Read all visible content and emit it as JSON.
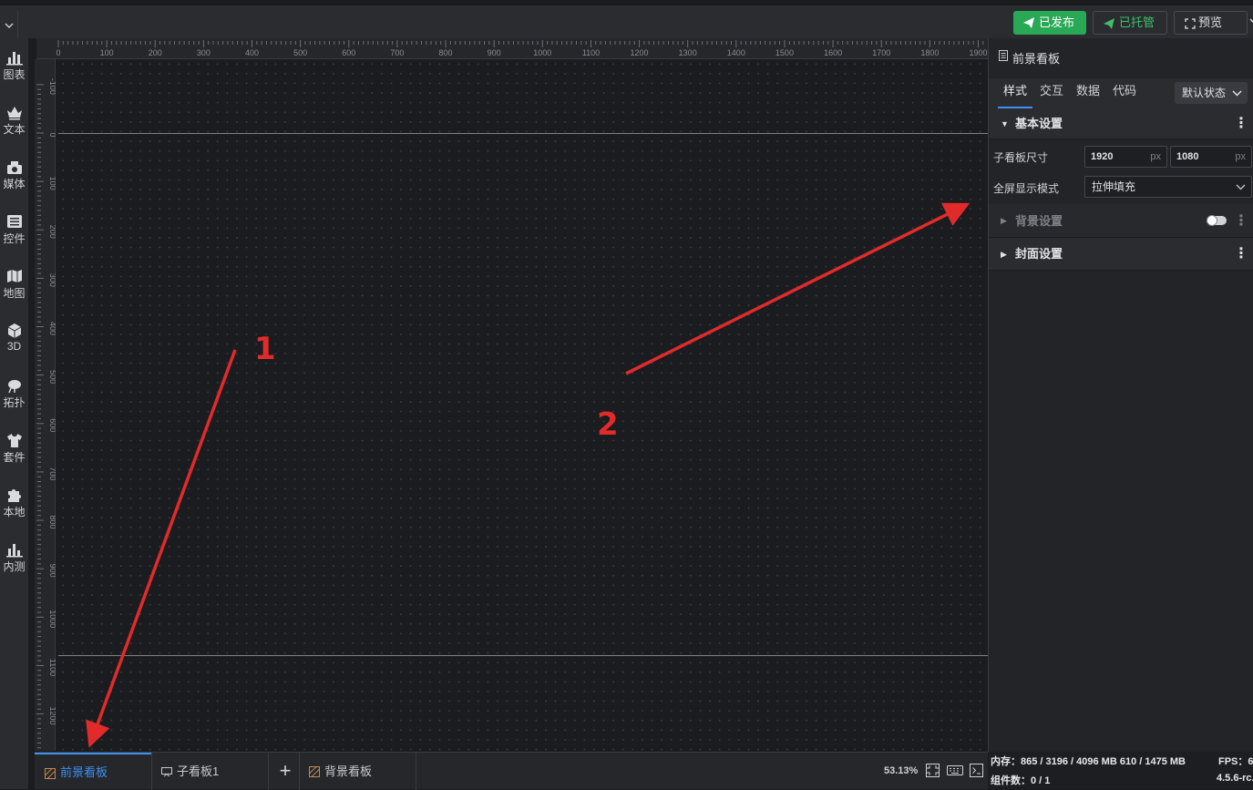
{
  "toolbar": {
    "published_label": "已发布",
    "hosted_label": "已托管",
    "preview_label": "预览"
  },
  "sidebar": {
    "items": [
      {
        "label": "图表",
        "icon": "bar-chart-icon"
      },
      {
        "label": "文本",
        "icon": "crown-text-icon"
      },
      {
        "label": "媒体",
        "icon": "media-camera-icon"
      },
      {
        "label": "控件",
        "icon": "widget-list-icon"
      },
      {
        "label": "地图",
        "icon": "map-icon"
      },
      {
        "label": "3D",
        "icon": "cube-icon"
      },
      {
        "label": "拓扑",
        "icon": "topology-icon"
      },
      {
        "label": "套件",
        "icon": "tshirt-kit-icon"
      },
      {
        "label": "本地",
        "icon": "puzzle-local-icon"
      },
      {
        "label": "内测",
        "icon": "beta-chart-icon"
      }
    ]
  },
  "ruler": {
    "top_labels": [
      "0",
      "100",
      "200",
      "300",
      "400",
      "500",
      "600",
      "700",
      "800",
      "900",
      "1000",
      "1100",
      "1200",
      "1300",
      "1400",
      "1500",
      "1600",
      "1700",
      "1800",
      "1900"
    ],
    "left_labels": [
      "-100",
      "0",
      "100",
      "200",
      "300",
      "400",
      "500",
      "600",
      "700",
      "800",
      "900",
      "1000",
      "1100",
      "1200"
    ]
  },
  "annotations": {
    "arrow1_label": "1",
    "arrow2_label": "2",
    "color": "#e12b2b"
  },
  "bottom_tabs": {
    "tabs": [
      {
        "label": "前景看板",
        "icon": "foreground-board-icon",
        "active": true
      },
      {
        "label": "子看板1",
        "icon": "sub-board-icon",
        "active": false
      },
      {
        "label": "背景看板",
        "icon": "background-board-icon",
        "active": false
      }
    ],
    "add_label": "+",
    "zoom": "53.13%"
  },
  "right_panel": {
    "title": "前景看板",
    "tabs": [
      "样式",
      "交互",
      "数据",
      "代码"
    ],
    "active_tab": "样式",
    "state_select": "默认状态",
    "sections": {
      "basic": "基本设置",
      "background": "背景设置",
      "cover": "封面设置"
    },
    "size_label": "子看板尺寸",
    "width_value": "1920",
    "height_value": "1080",
    "unit": "px",
    "fullscreen_label": "全屏显示模式",
    "fullscreen_value": "拉伸填充"
  },
  "status": {
    "memory": "内存：865 / 3196 / 4096 MB  610 / 1475 MB",
    "fps": "FPS：6",
    "components": "组件数：0 / 1",
    "version": "4.5.6-rc."
  },
  "colors": {
    "accent": "#3d8ff0",
    "published": "#29a855",
    "hosted_text": "#3cc16a"
  }
}
